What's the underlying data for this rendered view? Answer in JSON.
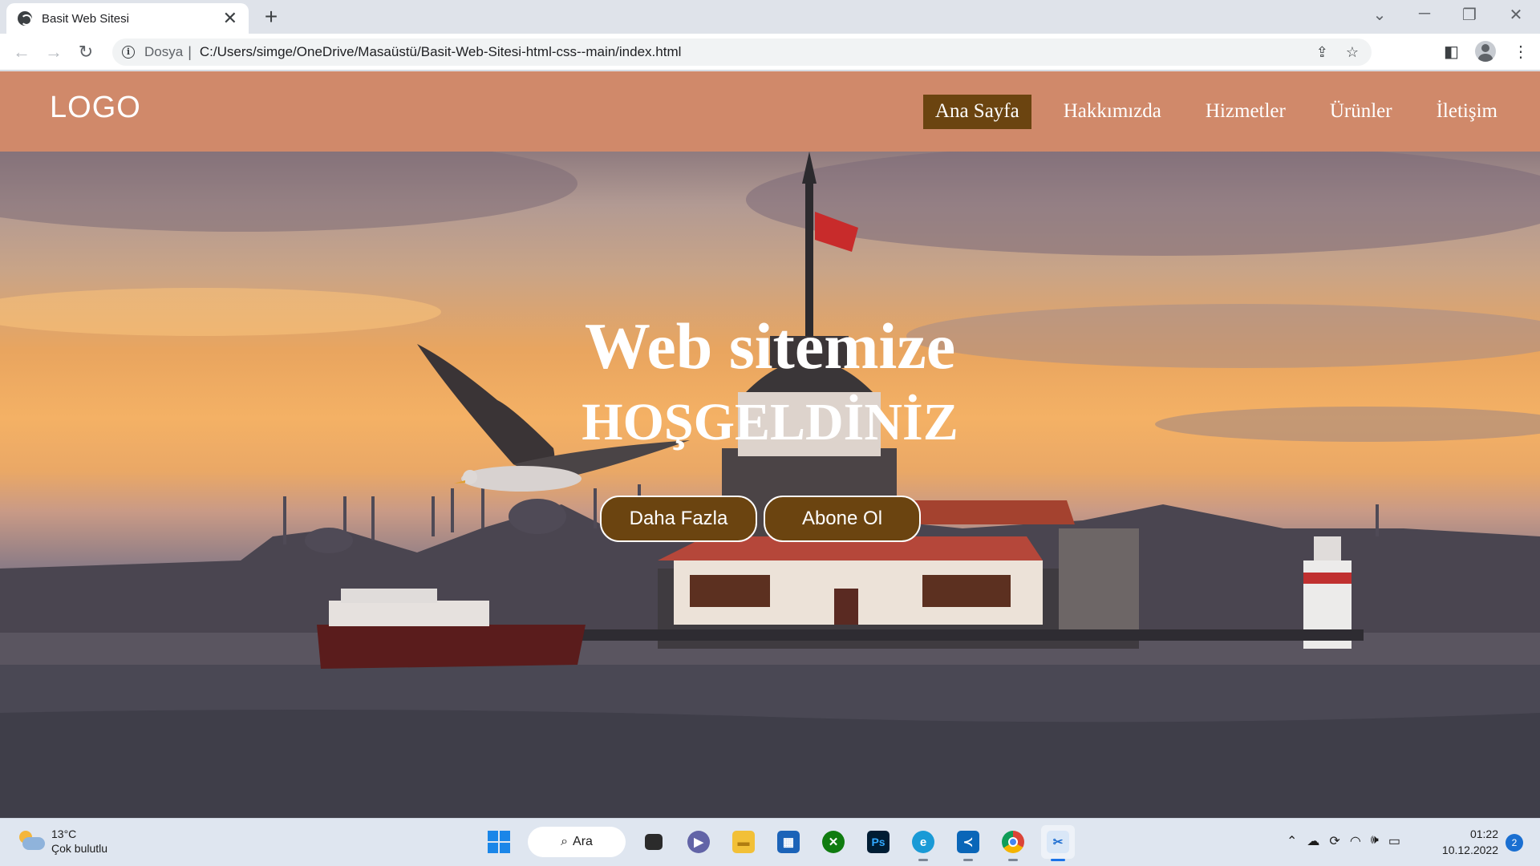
{
  "browser": {
    "tab_title": "Basit Web Sitesi",
    "tab_close": "✕",
    "new_tab": "+",
    "address": {
      "scheme_label": "Dosya",
      "separator": "|",
      "url": "C:/Users/simge/OneDrive/Masaüstü/Basit-Web-Sitesi-html-css--main/index.html"
    }
  },
  "site": {
    "logo": "LOGO",
    "nav": [
      {
        "label": "Ana Sayfa",
        "active": true
      },
      {
        "label": "Hakkımızda",
        "active": false
      },
      {
        "label": "Hizmetler",
        "active": false
      },
      {
        "label": "Ürünler",
        "active": false
      },
      {
        "label": "İletişim",
        "active": false
      }
    ],
    "hero": {
      "title": "Web sitemize",
      "subtitle": "HOŞGELDİNİZ",
      "buttons": [
        "Daha Fazla",
        "Abone Ol"
      ]
    },
    "colors": {
      "header_bg": "#d0896a",
      "active_nav_bg": "#6b4410",
      "button_bg": "#6b4410"
    }
  },
  "taskbar": {
    "weather": {
      "temp": "13°C",
      "condition": "Çok bulutlu"
    },
    "search_label": "Ara",
    "apps": [
      "task-view",
      "teams-chat",
      "file-explorer",
      "microsoft-store",
      "xbox",
      "photoshop",
      "edge",
      "vscode",
      "chrome",
      "snipping-tool"
    ],
    "clock": {
      "time": "01:22",
      "date": "10.12.2022"
    },
    "notification_count": "2"
  }
}
